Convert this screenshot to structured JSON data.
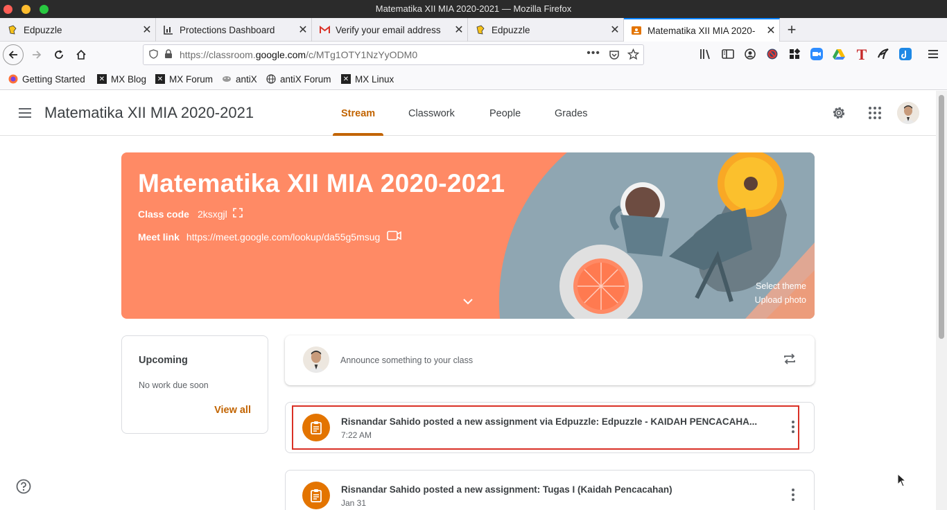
{
  "window": {
    "title": "Matematika XII MIA 2020-2021 — Mozilla Firefox"
  },
  "tabs": [
    {
      "label": "Edpuzzle",
      "icon": "edpuzzle-icon"
    },
    {
      "label": "Protections Dashboard",
      "icon": "chart-icon"
    },
    {
      "label": "Verify your email address",
      "icon": "gmail-icon"
    },
    {
      "label": "Edpuzzle",
      "icon": "edpuzzle-icon"
    },
    {
      "label": "Matematika XII MIA 2020-",
      "icon": "classroom-icon"
    }
  ],
  "url": {
    "prefix": "https://classroom.",
    "domain": "google.com",
    "path": "/c/MTg1OTY1NzYyODM0"
  },
  "bookmarks": [
    {
      "label": "Getting Started",
      "icon": "firefox-icon"
    },
    {
      "label": "MX Blog",
      "icon": "mx-icon"
    },
    {
      "label": "MX Forum",
      "icon": "mx-icon"
    },
    {
      "label": "antiX",
      "icon": "antix-icon"
    },
    {
      "label": "antiX Forum",
      "icon": "globe-icon"
    },
    {
      "label": "MX Linux",
      "icon": "mx-icon"
    }
  ],
  "app": {
    "title": "Matematika XII MIA 2020-2021",
    "tabs": [
      "Stream",
      "Classwork",
      "People",
      "Grades"
    ]
  },
  "banner": {
    "title": "Matematika XII MIA 2020-2021",
    "class_code_label": "Class code",
    "class_code": "2ksxgjl",
    "meet_label": "Meet link",
    "meet_url": "https://meet.google.com/lookup/da55g5msug",
    "select_theme": "Select theme",
    "upload_photo": "Upload photo"
  },
  "upcoming": {
    "title": "Upcoming",
    "empty": "No work due soon",
    "view_all": "View all"
  },
  "announce": {
    "placeholder": "Announce something to your class"
  },
  "posts": [
    {
      "text": "Risnandar Sahido posted a new assignment via Edpuzzle: Edpuzzle - KAIDAH PENCACAHA...",
      "time": "7:22 AM",
      "highlighted": true
    },
    {
      "text": "Risnandar Sahido posted a new assignment: Tugas I (Kaidah Pencacahan)",
      "time": "Jan 31",
      "highlighted": false
    }
  ],
  "colors": {
    "accent": "#c26401",
    "banner": "#ff8a65",
    "assignment_icon": "#e37400",
    "highlight": "#d93025"
  }
}
